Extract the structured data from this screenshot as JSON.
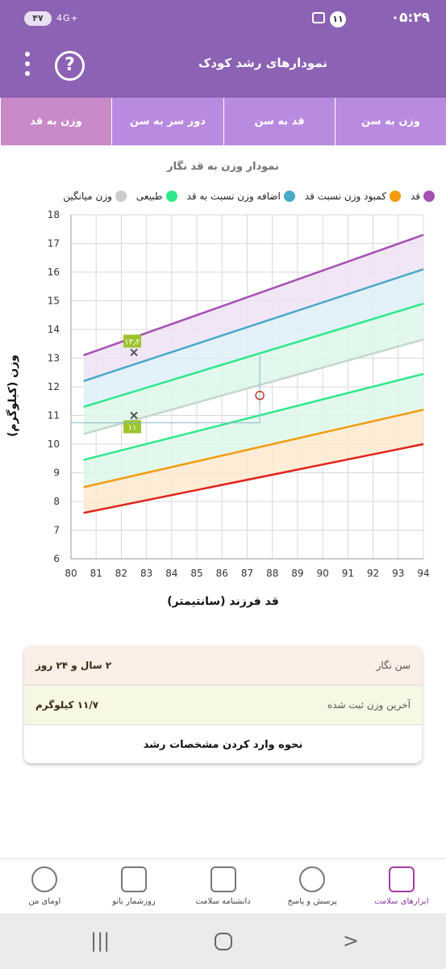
{
  "status": {
    "time": "۰۵:۲۹",
    "notification_count": "۱۱",
    "battery": "۴۷",
    "network": "4G+"
  },
  "appbar": {
    "title": "نمودارهای رشد کودک",
    "help_symbol": "?"
  },
  "tabs": [
    {
      "label": "وزن به سن",
      "active": false
    },
    {
      "label": "قد به سن",
      "active": false
    },
    {
      "label": "دور سر به سن",
      "active": false
    },
    {
      "label": "وزن به قد",
      "active": true
    }
  ],
  "chart_title": "نمودار وزن به قد نگار",
  "legend": [
    {
      "label": "قد",
      "color": "#a64fb4"
    },
    {
      "label": "کمبود وزن نسبت قد",
      "color": "#f39c12"
    },
    {
      "label": "اضافه وزن نسبت به قد",
      "color": "#4aa8c8"
    },
    {
      "label": "طبیعی",
      "color": "#2ee88a"
    },
    {
      "label": "وزن میانگین",
      "color": "#cccccc"
    }
  ],
  "chart_data": {
    "type": "line",
    "xlabel": "قد فرزند (سانتیمتر)",
    "ylabel": "وزن (کیلوگرم)",
    "xlim": [
      80,
      94
    ],
    "ylim": [
      6,
      18
    ],
    "x_ticks": [
      80,
      81,
      82,
      83,
      84,
      85,
      86,
      87,
      88,
      89,
      90,
      91,
      92,
      93,
      94
    ],
    "y_ticks": [
      6,
      7,
      8,
      9,
      10,
      11,
      12,
      13,
      14,
      15,
      16,
      17,
      18
    ],
    "grid": true,
    "x_start": 80.5,
    "x_end": 94,
    "series": [
      {
        "name": "قد",
        "color": "#a64fb4",
        "fill": "#efe2f3",
        "start": 13.1,
        "end": 17.3
      },
      {
        "name": "اضافه وزن نسبت به قد",
        "color": "#4aa8c8",
        "fill": "#deeef8",
        "start": 12.2,
        "end": 16.1
      },
      {
        "name": "طبیعی",
        "color": "#2ee88a",
        "fill": "#ddf7ea",
        "start": 11.3,
        "end": 14.9
      },
      {
        "name": "وزن میانگین",
        "color": "#c4d6cc",
        "fill": null,
        "start": 10.35,
        "end": 13.65
      },
      {
        "name": "طبیعی",
        "color": "#2ee88a",
        "fill": "#ddf7ea",
        "start": 9.45,
        "end": 12.45
      },
      {
        "name": "کمبود وزن نسبت قد",
        "color": "#f39c12",
        "fill": "#fde9cf",
        "start": 8.5,
        "end": 11.2
      },
      {
        "name": "",
        "color": "#e0241b",
        "fill": "#fbd3d3",
        "start": 7.6,
        "end": 10.0
      }
    ],
    "markers": [
      {
        "x": 82.5,
        "y": 13.2,
        "label": "۱۳٫۲",
        "symbol": "x"
      },
      {
        "x": 82.5,
        "y": 11.0,
        "label": "۱۱",
        "symbol": "x"
      },
      {
        "x": 87.5,
        "y": 11.7,
        "label": "",
        "symbol": "circle"
      }
    ]
  },
  "info_card": {
    "age_label": "سن نگار",
    "age_value": "۲ سال و ۲۴ روز",
    "weight_label": "آخرین وزن ثبت شده",
    "weight_value": "۱۱/۷ کیلوگرم",
    "help_link": "نحوه وارد کردن مشخصات رشد"
  },
  "bottom_nav": [
    {
      "label": "ابزارهای سلامت",
      "icon": "medical-kit-icon",
      "active": true
    },
    {
      "label": "پرسش و پاسخ",
      "icon": "question-bubble-icon",
      "active": false
    },
    {
      "label": "دانشنامه سلامت",
      "icon": "encyclopedia-icon",
      "active": false
    },
    {
      "label": "روزشمار بانو",
      "icon": "calendar-icon",
      "active": false
    },
    {
      "label": "اومای من",
      "icon": "profile-icon",
      "active": false
    }
  ]
}
